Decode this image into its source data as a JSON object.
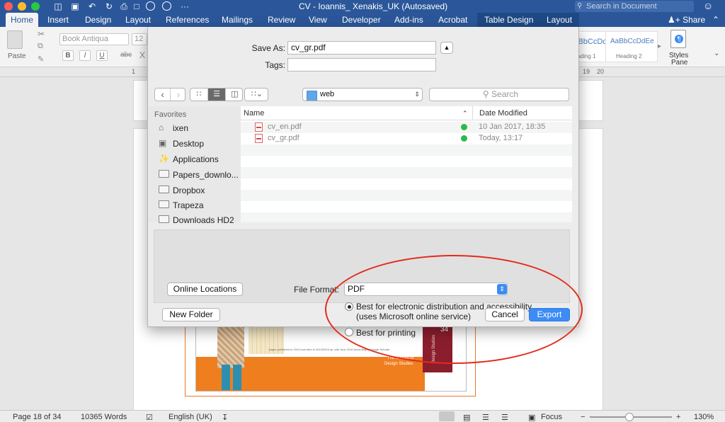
{
  "titlebar": {
    "title": "CV - Ioannis_ Xenakis_UK (Autosaved)",
    "search_placeholder": "Search in Document",
    "search_icon": "magnifier-icon",
    "smiley_icon": "smiley-icon"
  },
  "tabs": [
    "Home",
    "Insert",
    "Design",
    "Layout",
    "References",
    "Mailings",
    "Review",
    "View",
    "Developer",
    "Add-ins",
    "Acrobat",
    "Table Design",
    "Layout"
  ],
  "share_label": "Share",
  "ribbon": {
    "paste_label": "Paste",
    "font_name": "Book Antiqua",
    "font_size": "12",
    "bold": "B",
    "italic": "I",
    "underline": "U",
    "strike": "abc",
    "style1_sample": "AaBbCcDc",
    "style1_name": "Heading 1",
    "style2_sample": "AaBbCcDdEe",
    "style2_name": "Heading 2",
    "styles_pane_line1": "Styles",
    "styles_pane_line2": "Pane"
  },
  "ruler": {
    "n1": "1",
    "n2": "19",
    "n3": "20"
  },
  "dialog": {
    "save_as_label": "Save As:",
    "save_as_value": "cv_gr.pdf",
    "tags_label": "Tags:",
    "tags_value": "",
    "location": "web",
    "search_placeholder": "Search",
    "sidebar_header": "Favorites",
    "sidebar_items": [
      "ixen",
      "Desktop",
      "Applications",
      "Papers_downlo...",
      "Dropbox",
      "Trapeza",
      "Downloads HD2"
    ],
    "col_name": "Name",
    "col_date": "Date Modified",
    "files": [
      {
        "name": "cv_en.pdf",
        "date": "10 Jan 2017, 18:35"
      },
      {
        "name": "cv_gr.pdf",
        "date": "Today, 13:17"
      }
    ],
    "online_locations": "Online Locations",
    "file_format_label": "File Format:",
    "file_format_value": "PDF",
    "option1_line1": "Best for electronic distribution and accessibility",
    "option1_line2": "(uses Microsoft online service)",
    "option2": "Best for printing",
    "new_folder": "New Folder",
    "cancel": "Cancel",
    "export": "Export"
  },
  "document": {
    "footnote": "*paper published in 2013 and cited in 2014/2015 up until June 2016 according to Google Scholar",
    "editors_line1": "The Editors of",
    "editors_line2": "Design Studies",
    "journal_title": "Design Studies",
    "journal_issue": "34"
  },
  "statusbar": {
    "page": "Page 18 of 34",
    "words": "10365 Words",
    "language": "English (UK)",
    "focus": "Focus",
    "zoom": "130%"
  },
  "colors": {
    "word_blue": "#2b579a",
    "export_blue": "#3d8cf5",
    "annotation_red": "#e32b1c",
    "check_green": "#2eb84a"
  }
}
